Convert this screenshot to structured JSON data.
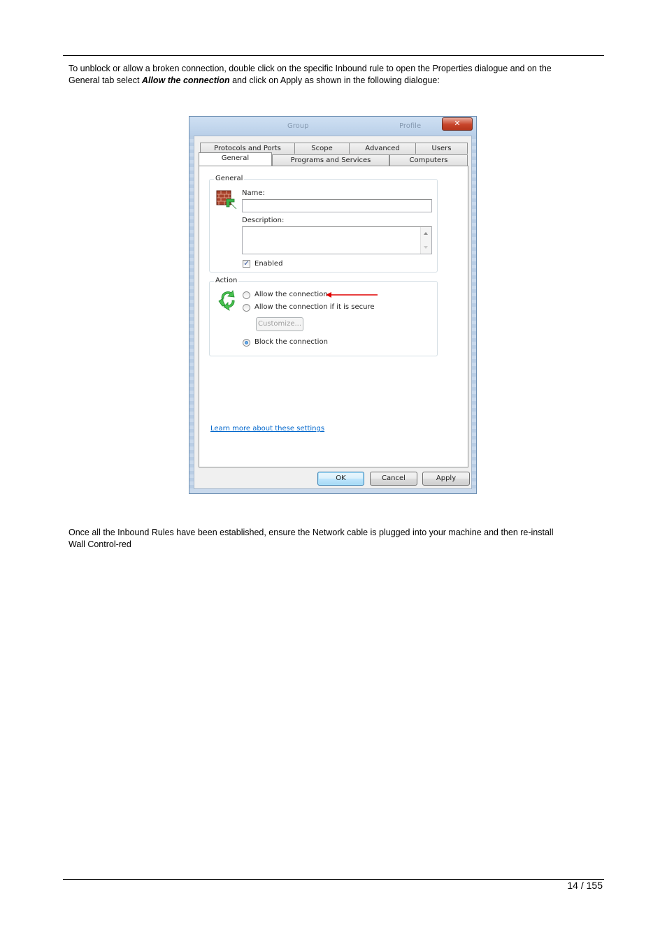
{
  "intro": {
    "line1": "To unblock or allow a broken connection, double click on the specific Inbound rule to open the Properties dialogue and on the",
    "line2_pre": "General tab select ",
    "line2_em": "Allow the connection",
    "line2_post": " and click on Apply as shown in the following dialogue:"
  },
  "dialog": {
    "title": "Group",
    "title_right": "Profile",
    "close_glyph": "✕",
    "tabs_row1": [
      "Protocols and Ports",
      "Scope",
      "Advanced",
      "Users"
    ],
    "tabs_row2": [
      "General",
      "Programs and Services",
      "Computers"
    ],
    "general_group": {
      "label": "General",
      "name_label": "Name:",
      "name_value": "",
      "description_label": "Description:",
      "description_value": "",
      "enabled_label": "Enabled",
      "enabled_checked": true
    },
    "action_group": {
      "label": "Action",
      "options": [
        {
          "label": "Allow the connection",
          "selected": false
        },
        {
          "label": "Allow the connection if it is secure",
          "selected": false
        },
        {
          "label": "Block the connection",
          "selected": true
        }
      ],
      "customize_label": "Customize..."
    },
    "learn_more_link": "Learn more about these settings",
    "buttons": {
      "ok": "OK",
      "cancel": "Cancel",
      "apply": "Apply"
    },
    "icons": {
      "general": "firewall-brick-icon",
      "action": "recycle-arrows-icon"
    },
    "colors": {
      "annotation_arrow": "#e00000",
      "link": "#0066cc"
    }
  },
  "outro": {
    "line1": "Once all the Inbound Rules have been established, ensure the Network cable is plugged into your machine and then re-install",
    "line2": "Wall Control-red"
  },
  "footer": {
    "page": "14 / 155"
  }
}
